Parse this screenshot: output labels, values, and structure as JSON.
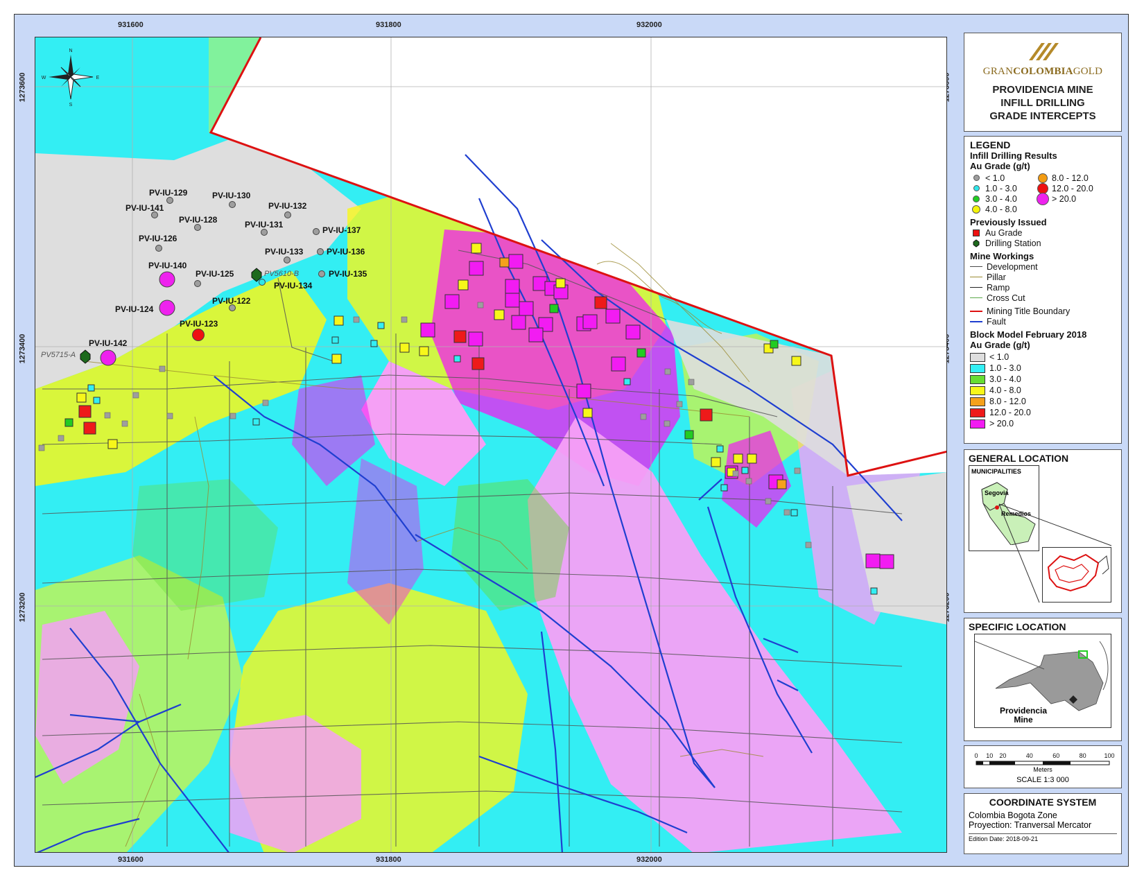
{
  "coords": {
    "x_ticks": [
      "931600",
      "931800",
      "932000"
    ],
    "y_ticks": [
      "1273600",
      "1273400",
      "1273200"
    ]
  },
  "map": {
    "compass": {
      "n": "N",
      "s": "S",
      "e": "E",
      "w": "W"
    },
    "hole_labels": [
      "PV-IU-129",
      "PV-IU-130",
      "PV-IU-141",
      "PV-IU-132",
      "PV-IU-128",
      "PV-IU-131",
      "PV-IU-137",
      "PV-IU-126",
      "PV-IU-133",
      "PV-IU-136",
      "PV-IU-140",
      "PV-IU-125",
      "PV-IU-135",
      "PV-IU-134",
      "PV-IU-122",
      "PV-IU-124",
      "PV-IU-123",
      "PV-IU-142"
    ],
    "stations": [
      "PV5610-B",
      "PV5715-A"
    ]
  },
  "title": {
    "brand_a": "GRAN",
    "brand_b": "COLOMBIA",
    "brand_c": "GOLD",
    "line1": "PROVIDENCIA MINE",
    "line2": "INFILL DRILLING",
    "line3": "GRADE INTERCEPTS"
  },
  "legend": {
    "heading": "LEGEND",
    "infill_title": "Infill Drilling Results",
    "infill_sub": "Au Grade (g/t)",
    "infill_left": [
      {
        "label": "< 1.0",
        "color": "#9e9e9e",
        "size": 7
      },
      {
        "label": "1.0 - 3.0",
        "color": "#2fe6ea",
        "size": 7
      },
      {
        "label": "3.0 - 4.0",
        "color": "#22cc22",
        "size": 8
      },
      {
        "label": "4.0 - 8.0",
        "color": "#f4f40a",
        "size": 10
      }
    ],
    "infill_right": [
      {
        "label": "8.0 - 12.0",
        "color": "#f39c12",
        "size": 12
      },
      {
        "label": "12.0 - 20.0",
        "color": "#ee1111",
        "size": 14
      },
      {
        "label": "> 20.0",
        "color": "#ee22ee",
        "size": 16
      }
    ],
    "prev_title": "Previously Issued",
    "prev_au": "Au Grade",
    "prev_station": "Drilling Station",
    "workings_title": "Mine Workings",
    "workings": [
      {
        "label": "Development",
        "color": "#4a4a4a"
      },
      {
        "label": "Pillar",
        "color": "#9a8a30"
      },
      {
        "label": "Ramp",
        "color": "#222222"
      },
      {
        "label": "Cross Cut",
        "color": "#5aa94a"
      }
    ],
    "boundary": {
      "label": "Mining Title Boundary",
      "color": "#dd1111"
    },
    "fault": {
      "label": "Fault",
      "color": "#1f3fd0"
    },
    "block_title": "Block Model February 2018",
    "block_sub": "Au Grade (g/t)",
    "block": [
      {
        "label": "< 1.0",
        "color": "#dedede"
      },
      {
        "label": "1.0 - 3.0",
        "color": "#33f0f5"
      },
      {
        "label": "3.0 - 4.0",
        "color": "#66dd33"
      },
      {
        "label": "4.0 - 8.0",
        "color": "#f7f71a"
      },
      {
        "label": "8.0 - 12.0",
        "color": "#f5a11b"
      },
      {
        "label": "12.0 - 20.0",
        "color": "#ee1a1a"
      },
      {
        "label": "> 20.0",
        "color": "#f21cf2"
      }
    ]
  },
  "general": {
    "heading": "GENERAL LOCATION",
    "municipalities": "MUNICIPALITIES",
    "segovia": "Segovia",
    "remedios": "Remedios"
  },
  "specific": {
    "heading": "SPECIFIC LOCATION",
    "mine_line1": "Providencia",
    "mine_line2": "Mine"
  },
  "scale": {
    "ticks": [
      "0",
      "10",
      "20",
      "40",
      "60",
      "80",
      "100"
    ],
    "unit": "Meters",
    "label": "SCALE",
    "ratio": "1:3 000"
  },
  "coordsys": {
    "heading": "COORDINATE SYSTEM",
    "zone": "Colombia Bogota Zone",
    "projection": "Proyection: Tranversal Mercator",
    "edition": "Edition Date: 2018-09-21"
  }
}
